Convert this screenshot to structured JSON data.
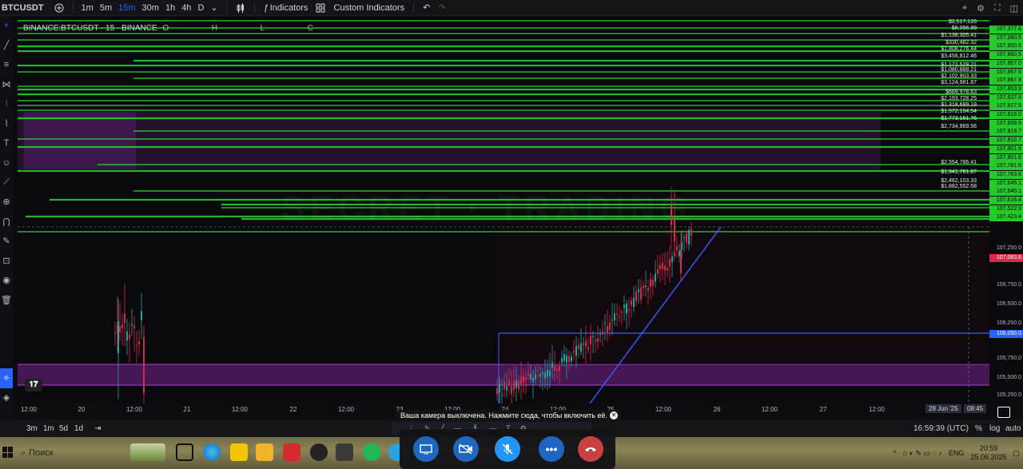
{
  "toolbar": {
    "symbol": "BTCUSDT",
    "timeframes": [
      "1m",
      "5m",
      "15m",
      "30m",
      "1h",
      "4h",
      "D"
    ],
    "active_timeframe": "15m",
    "indicators_label": "Indicators",
    "custom_indicators_label": "Custom Indicators"
  },
  "chart": {
    "legend": "BINANCE:BTCUSDT · 15 · BINANCE",
    "legend_o": "O",
    "legend_h": "H",
    "legend_l": "L",
    "legend_c": "C",
    "value_tags": [
      "$2,517,126",
      "$8,056.99",
      "$1,138,305.41",
      "$330,482.32",
      "$1,808,276.44",
      "$3,456,812.46",
      "$1,172,529.21",
      "$1,080,868.21",
      "$2,102,903.33",
      "$3,124,981.87",
      "$669,978.63",
      "$2,193,728.25",
      "$1,318,699.19",
      "$1,572,104.54",
      "$1,773,161.76",
      "$2,734,969.56",
      "$2,554,786.41",
      "$1,941,761.87",
      "$2,482,103.33",
      "$1,882,552.58"
    ]
  },
  "price_axis": {
    "green_labels": [
      "107,377.6",
      "107,980.5",
      "107,950.5",
      "107,860.5",
      "107,867.0",
      "107,867.5",
      "107,867.9",
      "107,853.9",
      "107,837.9",
      "107,827.5",
      "107,819.0",
      "107,839.9",
      "107,819.7",
      "107,810.7",
      "107,801.6",
      "107,801.6",
      "107,781.6",
      "107,763.6",
      "107,649.1",
      "107,640.1",
      "107,616.4",
      "107,522.9",
      "107,423.4"
    ],
    "plain_labels": [
      "107,250.0",
      "106,750.0",
      "106,500.0",
      "106,250.0",
      "105,750.0",
      "105,500.0",
      "105,250.0"
    ],
    "current_price": "107,083.6",
    "blue_level": "106,050.0"
  },
  "time_axis": {
    "ticks": [
      "12:00",
      "20",
      "12:00",
      "21",
      "12:00",
      "22",
      "12:00",
      "23",
      "12:00",
      "24",
      "12:00",
      "25",
      "12:00",
      "26",
      "12:00",
      "27",
      "12:00"
    ],
    "cursor_date": "28 Jun '25",
    "cursor_time": "08:45"
  },
  "bottom": {
    "ranges": [
      "3m",
      "1m",
      "5d",
      "1d"
    ],
    "clock": "16:59:39 (UTC)",
    "percent": "%",
    "log": "log",
    "auto": "auto"
  },
  "banner": {
    "text": "Ваша камера выключена. Нажмите сюда, чтобы включить её."
  },
  "taskbar": {
    "search_placeholder": "Поиск",
    "lang": "ENG",
    "time": "20:59",
    "date": "25.06.2025"
  },
  "colors": {
    "green": "#25c92d",
    "purple_zone": "#4a1a5c",
    "blue_line": "#3c5cff",
    "red_candle": "#d22c4a"
  }
}
